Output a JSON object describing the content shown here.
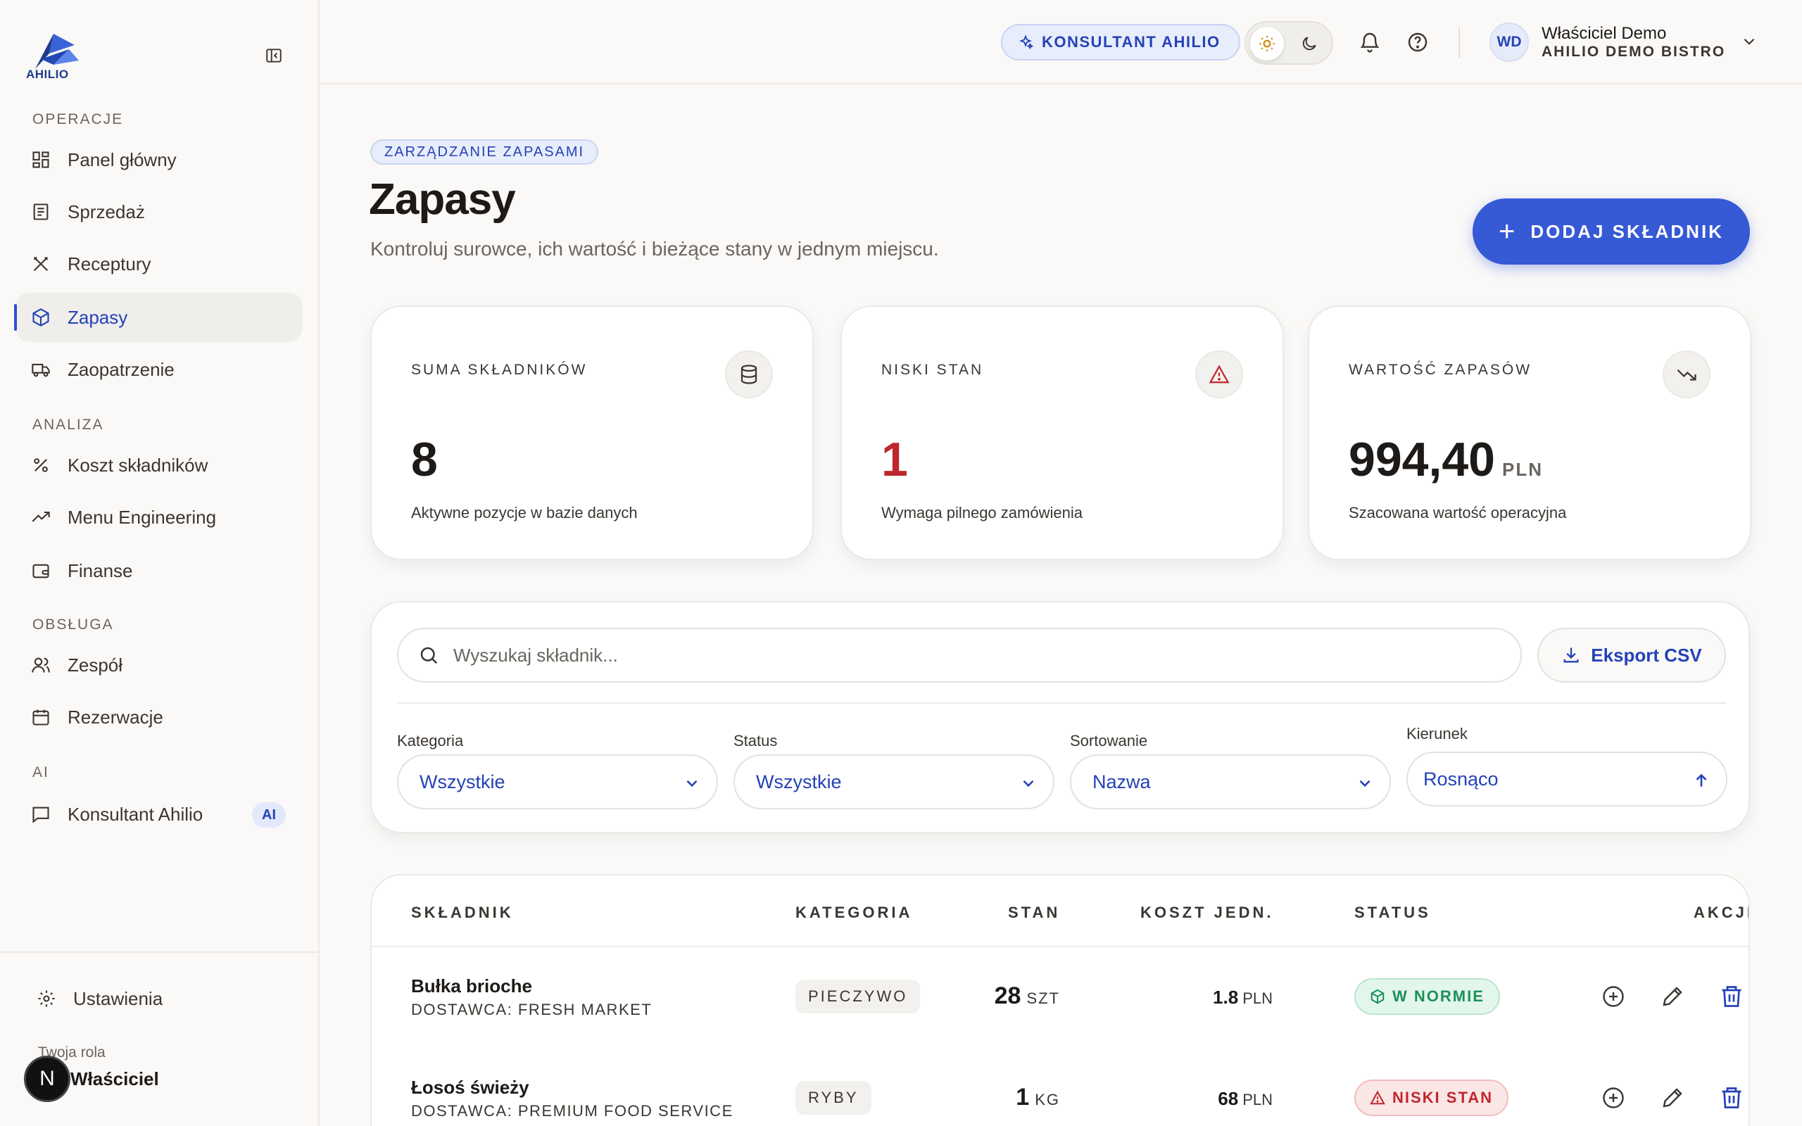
{
  "brand": {
    "logo_text": "AHILIO"
  },
  "sidebar": {
    "sections": [
      {
        "label": "OPERACJE"
      },
      {
        "label": "ANALIZA"
      },
      {
        "label": "OBSŁUGA"
      },
      {
        "label": "AI"
      }
    ],
    "items": [
      {
        "label": "Panel główny",
        "icon": "dashboard-icon"
      },
      {
        "label": "Sprzedaż",
        "icon": "receipt-icon"
      },
      {
        "label": "Receptury",
        "icon": "utensils-icon"
      },
      {
        "label": "Zapasy",
        "icon": "package-icon",
        "active": true
      },
      {
        "label": "Zaopatrzenie",
        "icon": "truck-icon"
      },
      {
        "label": "Koszt składników",
        "icon": "percent-icon"
      },
      {
        "label": "Menu Engineering",
        "icon": "trending-up-icon"
      },
      {
        "label": "Finanse",
        "icon": "wallet-icon"
      },
      {
        "label": "Zespół",
        "icon": "users-icon"
      },
      {
        "label": "Rezerwacje",
        "icon": "calendar-icon"
      },
      {
        "label": "Konsultant Ahilio",
        "icon": "chat-icon",
        "badge": "AI"
      }
    ],
    "settings_label": "Ustawienia",
    "role_label": "Twoja rola",
    "role_value": "Właściciel",
    "n_badge": "N"
  },
  "topbar": {
    "konsultant_label": "KONSULTANT AHILIO",
    "user_initials": "WD",
    "user_name": "Właściciel Demo",
    "user_org": "AHILIO DEMO BISTRO"
  },
  "header": {
    "badge": "ZARZĄDZANIE ZAPASAMI",
    "title": "Zapasy",
    "subtitle": "Kontroluj surowce, ich wartość i bieżące stany w jednym miejscu.",
    "add_button": "DODAJ SKŁADNIK"
  },
  "stats": [
    {
      "label": "SUMA SKŁADNIKÓW",
      "value": "8",
      "unit": "",
      "desc": "Aktywne pozycje w bazie danych",
      "icon": "database-icon"
    },
    {
      "label": "NISKI STAN",
      "value": "1",
      "unit": "",
      "desc": "Wymaga pilnego zamówienia",
      "icon": "alert-triangle-icon"
    },
    {
      "label": "WARTOŚĆ ZAPASÓW",
      "value": "994,40",
      "unit": "PLN",
      "desc": "Szacowana wartość operacyjna",
      "icon": "trending-down-icon"
    }
  ],
  "filters": {
    "search_placeholder": "Wyszukaj składnik...",
    "export_label": "Eksport CSV",
    "kategoria": {
      "label": "Kategoria",
      "value": "Wszystkie"
    },
    "status": {
      "label": "Status",
      "value": "Wszystkie"
    },
    "sortowanie": {
      "label": "Sortowanie",
      "value": "Nazwa"
    },
    "kierunek": {
      "label": "Kierunek",
      "value": "Rosnąco"
    }
  },
  "table": {
    "columns": [
      "SKŁADNIK",
      "KATEGORIA",
      "STAN",
      "KOSZT JEDN.",
      "STATUS",
      "AKCJE"
    ],
    "rows": [
      {
        "name": "Bułka brioche",
        "supplier": "DOSTAWCA: FRESH MARKET",
        "category": "PIECZYWO",
        "stock": "28",
        "stock_unit": "SZT",
        "cost": "1.8",
        "cost_unit": "PLN",
        "status": "W NORMIE",
        "status_type": "ok"
      },
      {
        "name": "Łosoś świeży",
        "supplier": "DOSTAWCA: PREMIUM FOOD SERVICE",
        "category": "RYBY",
        "stock": "1",
        "stock_unit": "KG",
        "cost": "68",
        "cost_unit": "PLN",
        "status": "NISKI STAN",
        "status_type": "low"
      }
    ]
  },
  "colors": {
    "accent": "#3659d6",
    "danger": "#c0262d",
    "success": "#1c9158"
  }
}
